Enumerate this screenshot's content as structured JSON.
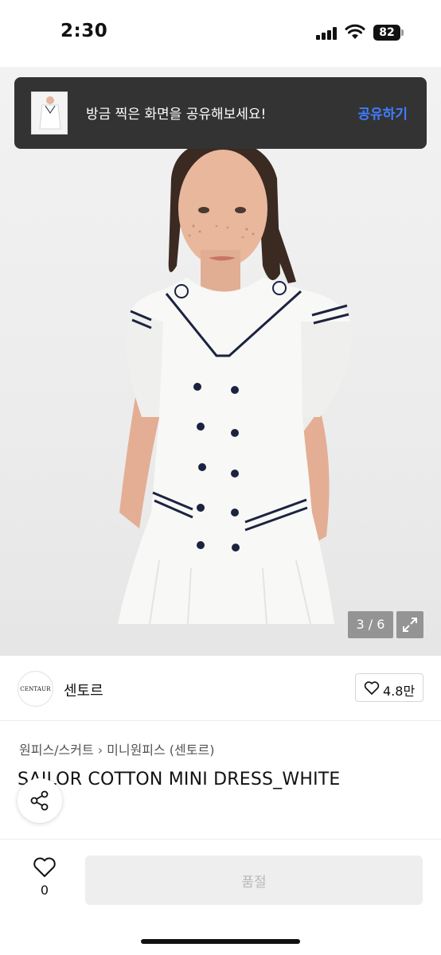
{
  "status_bar": {
    "time": "2:30",
    "battery": "82"
  },
  "toast": {
    "message": "방금 찍은 화면을 공유해보세요!",
    "action": "공유하기"
  },
  "gallery": {
    "counter": "3 / 6"
  },
  "brand": {
    "logo_text": "CENTAUR",
    "name": "센토르",
    "likes": "4.8만"
  },
  "breadcrumb": {
    "parent": "원피스/스커트",
    "child": "미니원피스 (센토르)"
  },
  "product": {
    "title": "SAILOR COTTON MINI DRESS_WHITE"
  },
  "bottom_bar": {
    "wish_count": "0",
    "status_button": "품절"
  },
  "colors": {
    "accent": "#3f7dff",
    "toast_bg": "#333333",
    "navy": "#1b2340"
  },
  "icons": [
    "signal-icon",
    "wifi-icon",
    "battery-icon",
    "expand-icon",
    "heart-icon",
    "share-icon"
  ]
}
